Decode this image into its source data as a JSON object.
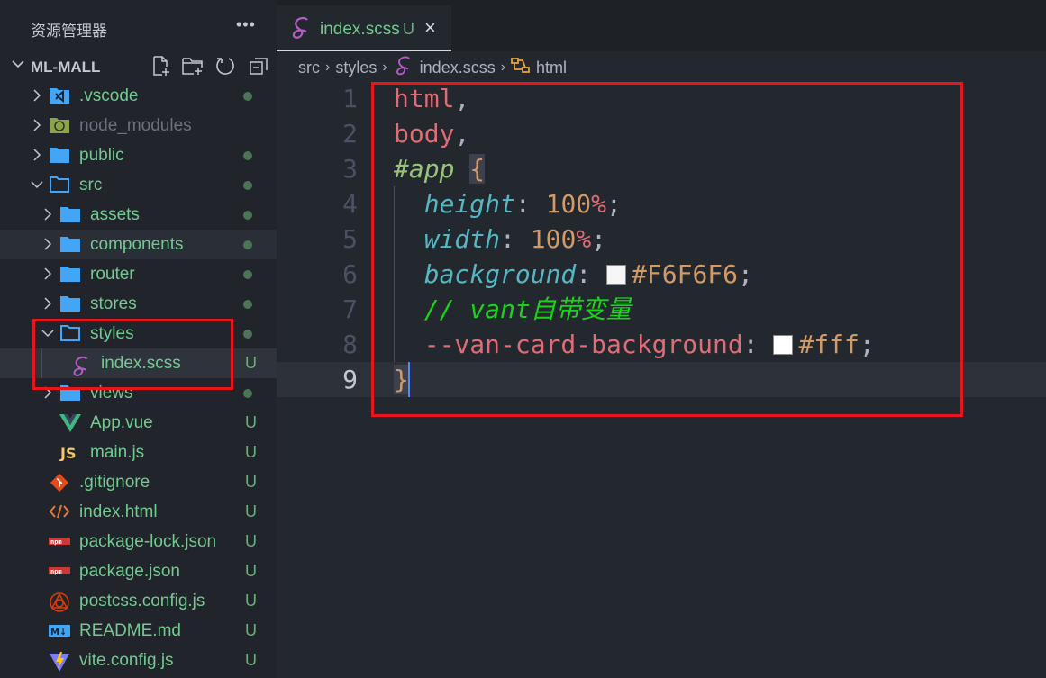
{
  "sidebar": {
    "title": "资源管理器",
    "more_icon": "ellipsis-icon",
    "project": "ML-MALL",
    "toolbar": [
      "new-file-icon",
      "new-folder-icon",
      "refresh-icon",
      "collapse-all-icon"
    ],
    "tree": [
      {
        "label": ".vscode",
        "depth": 0,
        "type": "folder",
        "expanded": false,
        "icon": "vscode-folder-icon",
        "status": "dot"
      },
      {
        "label": "node_modules",
        "depth": 0,
        "type": "folder",
        "expanded": false,
        "icon": "node-folder-icon",
        "status": "",
        "dim": true
      },
      {
        "label": "public",
        "depth": 0,
        "type": "folder",
        "expanded": false,
        "icon": "folder-icon",
        "status": "dot"
      },
      {
        "label": "src",
        "depth": 0,
        "type": "folder",
        "expanded": true,
        "icon": "folder-open-icon",
        "status": "dot"
      },
      {
        "label": "assets",
        "depth": 1,
        "type": "folder",
        "expanded": false,
        "icon": "folder-icon",
        "status": "dot"
      },
      {
        "label": "components",
        "depth": 1,
        "type": "folder",
        "expanded": false,
        "icon": "folder-icon",
        "status": "dot",
        "hover": true
      },
      {
        "label": "router",
        "depth": 1,
        "type": "folder",
        "expanded": false,
        "icon": "folder-icon",
        "status": "dot"
      },
      {
        "label": "stores",
        "depth": 1,
        "type": "folder",
        "expanded": false,
        "icon": "folder-icon",
        "status": "dot"
      },
      {
        "label": "styles",
        "depth": 1,
        "type": "folder",
        "expanded": true,
        "icon": "folder-open-icon",
        "status": "dot"
      },
      {
        "label": "index.scss",
        "depth": 2,
        "type": "file",
        "icon": "sass-icon",
        "status": "U",
        "selected": true
      },
      {
        "label": "views",
        "depth": 1,
        "type": "folder",
        "expanded": false,
        "icon": "folder-icon",
        "status": "dot"
      },
      {
        "label": "App.vue",
        "depth": 1,
        "type": "file",
        "icon": "vue-icon",
        "status": "U"
      },
      {
        "label": "main.js",
        "depth": 1,
        "type": "file",
        "icon": "javascript-icon",
        "status": "U"
      },
      {
        "label": ".gitignore",
        "depth": 0,
        "type": "file",
        "icon": "git-icon",
        "status": "U"
      },
      {
        "label": "index.html",
        "depth": 0,
        "type": "file",
        "icon": "html-icon",
        "status": "U"
      },
      {
        "label": "package-lock.json",
        "depth": 0,
        "type": "file",
        "icon": "npm-icon",
        "status": "U"
      },
      {
        "label": "package.json",
        "depth": 0,
        "type": "file",
        "icon": "npm-icon",
        "status": "U"
      },
      {
        "label": "postcss.config.js",
        "depth": 0,
        "type": "file",
        "icon": "postcss-icon",
        "status": "U"
      },
      {
        "label": "README.md",
        "depth": 0,
        "type": "file",
        "icon": "markdown-icon",
        "status": "U"
      },
      {
        "label": "vite.config.js",
        "depth": 0,
        "type": "file",
        "icon": "vite-icon",
        "status": "U"
      }
    ]
  },
  "tab": {
    "label": "index.scss",
    "status": "U",
    "close": "×"
  },
  "breadcrumb": [
    "src",
    "styles",
    "index.scss",
    "html"
  ],
  "editor": {
    "current_line": 9,
    "lines": [
      [
        [
          "html",
          "sel"
        ],
        [
          ",",
          "punc"
        ]
      ],
      [
        [
          "body",
          "sel"
        ],
        [
          ",",
          "punc"
        ]
      ],
      [
        [
          "#app",
          "id"
        ],
        [
          " ",
          "punc"
        ],
        [
          "{",
          "br"
        ]
      ],
      [
        [
          "  ",
          "punc"
        ],
        [
          "height",
          "prop"
        ],
        [
          ": ",
          "punc"
        ],
        [
          "100",
          "num"
        ],
        [
          "%",
          "unit"
        ],
        [
          ";",
          "punc"
        ]
      ],
      [
        [
          "  ",
          "punc"
        ],
        [
          "width",
          "prop"
        ],
        [
          ": ",
          "punc"
        ],
        [
          "100",
          "num"
        ],
        [
          "%",
          "unit"
        ],
        [
          ";",
          "punc"
        ]
      ],
      [
        [
          "  ",
          "punc"
        ],
        [
          "background",
          "prop"
        ],
        [
          ": ",
          "punc"
        ],
        [
          "#F6F6F6",
          "sw"
        ],
        [
          "#F6F6F6",
          "hex"
        ],
        [
          ";",
          "punc"
        ]
      ],
      [
        [
          "  ",
          "punc"
        ],
        [
          "// vant自带变量",
          "cmt"
        ]
      ],
      [
        [
          "  ",
          "punc"
        ],
        [
          "--van-card-background",
          "var"
        ],
        [
          ": ",
          "punc"
        ],
        [
          "#ffffff",
          "sw"
        ],
        [
          "#fff",
          "hex"
        ],
        [
          ";",
          "punc"
        ]
      ],
      [
        [
          "}",
          "br"
        ]
      ]
    ]
  },
  "colors": {
    "highlight_box": "#e8161c",
    "untracked": "#73c991",
    "folder": "#42a5f5"
  }
}
